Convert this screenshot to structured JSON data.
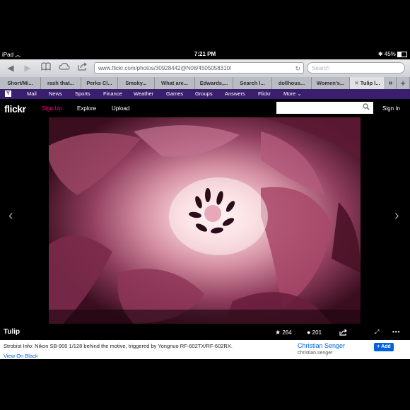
{
  "status_bar": {
    "device": "iPad",
    "time": "7:21 PM",
    "battery": "45%"
  },
  "browser": {
    "url": "www.flickr.com/photos/30928442@N08/4505058310/",
    "search_placeholder": "Search",
    "tabs": [
      {
        "label": "Short/Mi..."
      },
      {
        "label": "rash that..."
      },
      {
        "label": "Perks Cl..."
      },
      {
        "label": "Smoky..."
      },
      {
        "label": "What are..."
      },
      {
        "label": "Edwards,..."
      },
      {
        "label": "Search l..."
      },
      {
        "label": "dollhous..."
      },
      {
        "label": "Women's..."
      },
      {
        "label": "Tulip l..."
      }
    ]
  },
  "yahoo_bar": {
    "logo": "Y",
    "links": [
      "Mail",
      "News",
      "Sports",
      "Finance",
      "Weather",
      "Games",
      "Groups",
      "Answers",
      "Flickr",
      "More"
    ]
  },
  "flickr": {
    "logo": "flickr",
    "nav": {
      "signup": "Sign Up",
      "explore": "Explore",
      "upload": "Upload",
      "signin": "Sign In"
    },
    "accent_pink": "#ff0084",
    "accent_blue": "#0063dc"
  },
  "photo": {
    "title": "Tulip",
    "favorites": "264",
    "comments": "201",
    "description": "Strobist Info: Nikon SB-900 1/128 behind the motive, triggered by Yongnuo RF-602TX/RF-602RX.",
    "view_link": "View On Black",
    "author": "Christian Senger",
    "author_username": "christian.senger",
    "follow_label": "+ Add"
  }
}
